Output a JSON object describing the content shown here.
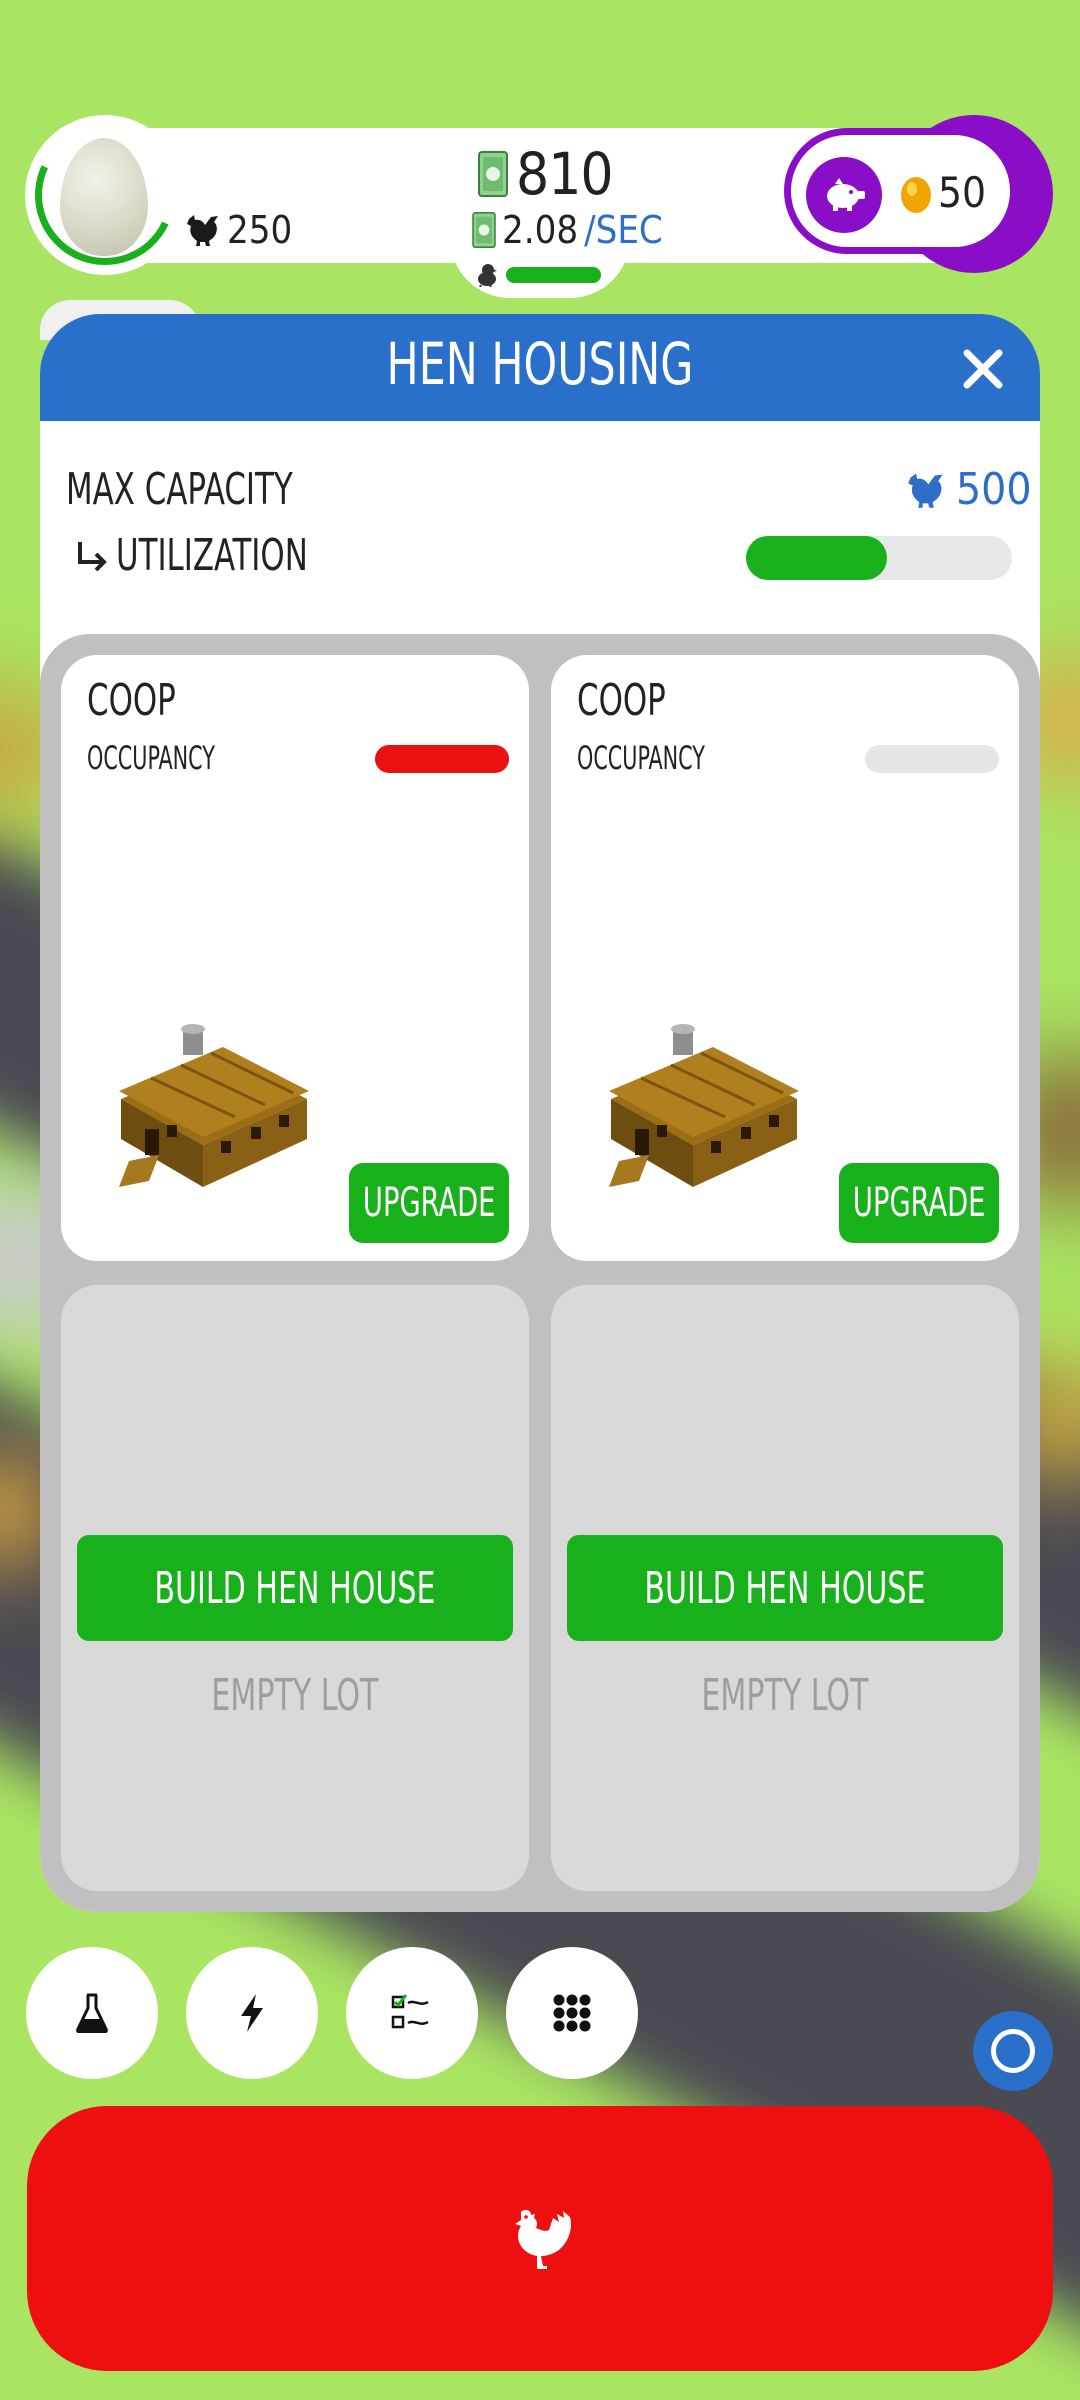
{
  "hud": {
    "hen_count": "250",
    "cash": "810",
    "rate_value": "2.08",
    "rate_unit": "/SEC",
    "chick_progress": 1.0,
    "golden_eggs": "50"
  },
  "modal": {
    "title": "HEN HOUSING",
    "max_capacity_label": "MAX CAPACITY",
    "max_capacity_value": "500",
    "utilization_label": "UTILIZATION",
    "utilization_fraction": 0.53,
    "houses": [
      {
        "name": "COOP",
        "occupancy_label": "OCCUPANCY",
        "occupancy_fraction": 1.0,
        "upgrade_label": "UPGRADE"
      },
      {
        "name": "COOP",
        "occupancy_label": "OCCUPANCY",
        "occupancy_fraction": 0.0,
        "upgrade_label": "UPGRADE"
      }
    ],
    "lots": [
      {
        "build_label": "BUILD HEN HOUSE",
        "status": "EMPTY LOT"
      },
      {
        "build_label": "BUILD HEN HOUSE",
        "status": "EMPTY LOT"
      }
    ]
  },
  "bottom_bar": {
    "buttons": [
      {
        "icon": "flask-icon"
      },
      {
        "icon": "lightning-icon"
      },
      {
        "icon": "checklist-icon"
      },
      {
        "icon": "grid-icon"
      }
    ],
    "main_action_icon": "chicken-icon"
  },
  "colors": {
    "accent_blue": "#2a6fc9",
    "green": "#18b01b",
    "red": "#ee0f10",
    "purple": "#8a0ec8",
    "grass": "#a9e562"
  }
}
